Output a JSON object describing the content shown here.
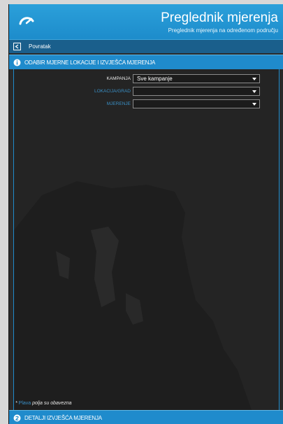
{
  "header": {
    "title": "Preglednik mjerenja",
    "subtitle": "Preglednik mjerenja na određenom području",
    "logo_icon": "gauge-icon"
  },
  "nav": {
    "back_label": "Povratak",
    "back_icon": "back-arrow-icon"
  },
  "section1": {
    "label": "ODABIR MJERNE LOKACIJE I IZVJEŠĆA MJERENJA",
    "icon": "info-icon",
    "fields": [
      {
        "label": "KAMPANJA",
        "value": "Sve kampanje"
      },
      {
        "label": "LOKACIJA/GRAD",
        "value": ""
      },
      {
        "label": "MJERENJE",
        "value": ""
      }
    ],
    "footnote_prefix": "* ",
    "footnote_req": "Plava",
    "footnote_text": " polja su obavezna"
  },
  "section2": {
    "label": "DETALJI IZVJEŠĆA MJERENJA",
    "icon": "number-2-icon"
  },
  "colors": {
    "accent": "#1f8bcc",
    "header": "#2ba0da",
    "nav": "#1a5f8c",
    "background": "#232323",
    "required_label": "#3a8fc5"
  }
}
